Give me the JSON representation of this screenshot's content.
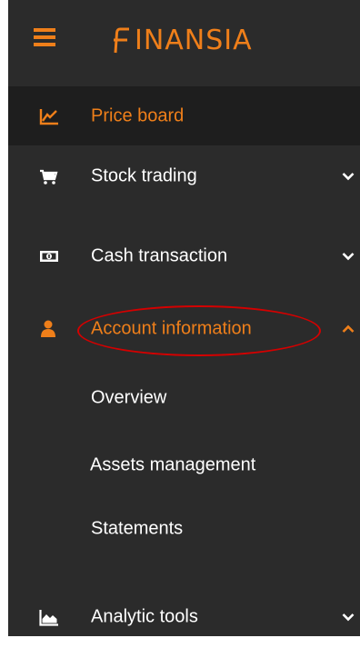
{
  "header": {
    "menu_icon": "hamburger-icon",
    "brand": "INANSIA",
    "brand_colors": {
      "accent": "#ef7f1a",
      "background": "#2b2b2b"
    }
  },
  "menu": {
    "items": [
      {
        "label": "Price board",
        "icon": "line-chart-icon",
        "active": true
      },
      {
        "label": "Stock trading",
        "icon": "cart-icon",
        "expanded": false
      },
      {
        "label": "Cash transaction",
        "icon": "cash-icon",
        "expanded": false
      },
      {
        "label": "Account information",
        "icon": "user-icon",
        "expanded": true
      },
      {
        "label": "Analytic tools",
        "icon": "area-chart-icon",
        "expanded": false
      }
    ],
    "account_submenu": [
      {
        "label": "Overview"
      },
      {
        "label": "Assets management"
      },
      {
        "label": "Statements"
      }
    ]
  },
  "annotation": {
    "shape": "ellipse",
    "color": "#d40000",
    "target": "Account information"
  }
}
